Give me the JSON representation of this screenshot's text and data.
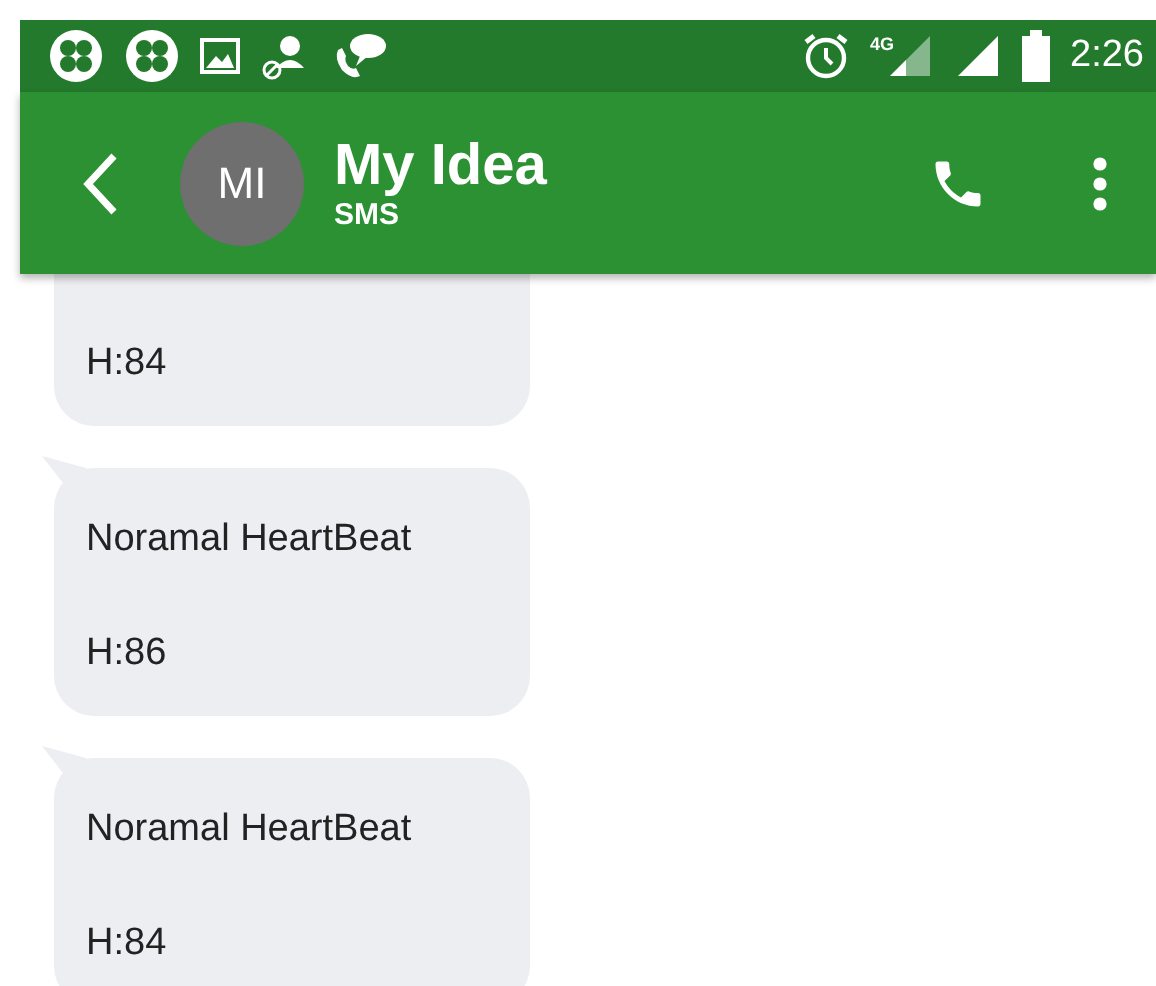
{
  "status_bar": {
    "network": "4G",
    "time": "2:26"
  },
  "app_bar": {
    "avatar_initials": "MI",
    "title": "My Idea",
    "subtitle": "SMS"
  },
  "messages": [
    {
      "lines": [
        "H:84"
      ]
    },
    {
      "lines": [
        "Noramal HeartBeat",
        "H:86"
      ]
    },
    {
      "lines": [
        "Noramal HeartBeat",
        "H:84"
      ]
    }
  ]
}
